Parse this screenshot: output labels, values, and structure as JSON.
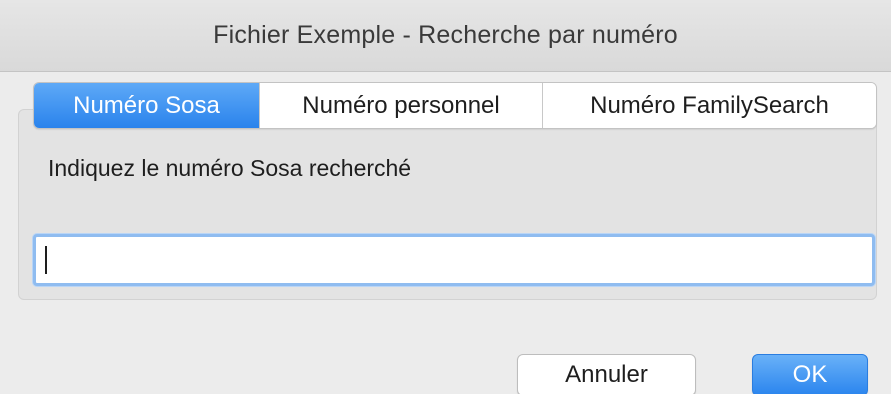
{
  "window": {
    "title": "Fichier Exemple - Recherche par numéro"
  },
  "tabs": [
    {
      "label": "Numéro Sosa",
      "selected": true
    },
    {
      "label": "Numéro personnel",
      "selected": false
    },
    {
      "label": "Numéro FamilySearch",
      "selected": false
    }
  ],
  "form": {
    "prompt": "Indiquez le numéro Sosa recherché",
    "value": ""
  },
  "buttons": {
    "cancel_label": "Annuler",
    "ok_label": "OK"
  },
  "colors": {
    "accent": "#2a83ec",
    "focus_ring": "#8fbcf0"
  }
}
